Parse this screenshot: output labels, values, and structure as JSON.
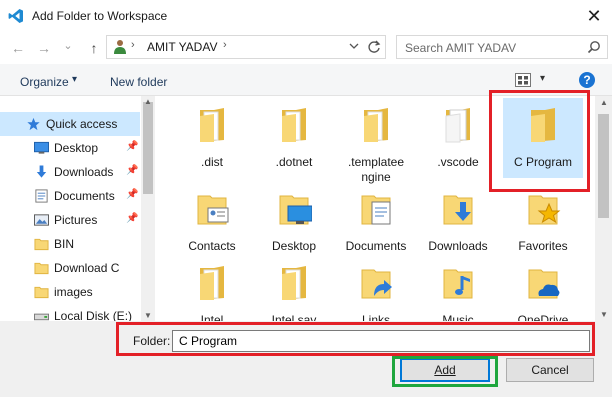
{
  "window": {
    "title": "Add Folder to Workspace",
    "close_glyph": "✕",
    "app_icon": "vscode-icon"
  },
  "nav": {
    "back_glyph": "←",
    "forward_glyph": "→",
    "recent_glyph": "⌄",
    "up_glyph": "↑",
    "address": {
      "path_segment": "AMIT YADAV",
      "separator": "›"
    },
    "search_placeholder": "Search AMIT YADAV"
  },
  "toolbar": {
    "organize": "Organize",
    "caret": "▾",
    "new_folder": "New folder",
    "help": "?"
  },
  "sidebar": {
    "items": [
      {
        "label": "Quick access",
        "icon": "star-icon",
        "pinned": false,
        "active": true
      },
      {
        "label": "Desktop",
        "icon": "desktop-icon",
        "pinned": true
      },
      {
        "label": "Downloads",
        "icon": "download-arrow-icon",
        "pinned": true
      },
      {
        "label": "Documents",
        "icon": "documents-icon",
        "pinned": true
      },
      {
        "label": "Pictures",
        "icon": "pictures-icon",
        "pinned": true
      },
      {
        "label": "BIN",
        "icon": "folder-icon",
        "pinned": false
      },
      {
        "label": "Download C",
        "icon": "folder-icon",
        "pinned": false
      },
      {
        "label": "images",
        "icon": "folder-icon",
        "pinned": false
      },
      {
        "label": "Local Disk (E:)",
        "icon": "drive-icon",
        "pinned": false
      }
    ],
    "pin_glyph": "📌"
  },
  "content": {
    "items": [
      {
        "label": ".dist",
        "icon": "folder-icon"
      },
      {
        "label": ".dotnet",
        "icon": "folder-icon"
      },
      {
        "label": ".templatee ngine",
        "icon": "folder-icon"
      },
      {
        "label": ".vscode",
        "icon": "folder-icon"
      },
      {
        "label": "C Program",
        "icon": "folder-icon",
        "selected": true
      },
      {
        "label": "Contacts",
        "icon": "contacts-folder-icon"
      },
      {
        "label": "Desktop",
        "icon": "desktop-folder-icon"
      },
      {
        "label": "Documents",
        "icon": "documents-folder-icon"
      },
      {
        "label": "Downloads",
        "icon": "downloads-folder-icon"
      },
      {
        "label": "Favorites",
        "icon": "favorites-folder-icon"
      },
      {
        "label": "Intel",
        "icon": "folder-icon"
      },
      {
        "label": "Intel.sav",
        "icon": "folder-icon"
      },
      {
        "label": "Links",
        "icon": "links-folder-icon"
      },
      {
        "label": "Music",
        "icon": "music-folder-icon"
      },
      {
        "label": "OneDrive",
        "icon": "onedrive-folder-icon"
      }
    ]
  },
  "footer": {
    "folder_label": "Folder:",
    "folder_value": "C Program",
    "add_label": "Add",
    "cancel_label": "Cancel"
  },
  "colors": {
    "highlight_red": "#e32027",
    "highlight_green": "#1fa63e",
    "selection": "#cce8ff",
    "folder_yellow": "#f8d775",
    "folder_dark": "#e5b740"
  }
}
